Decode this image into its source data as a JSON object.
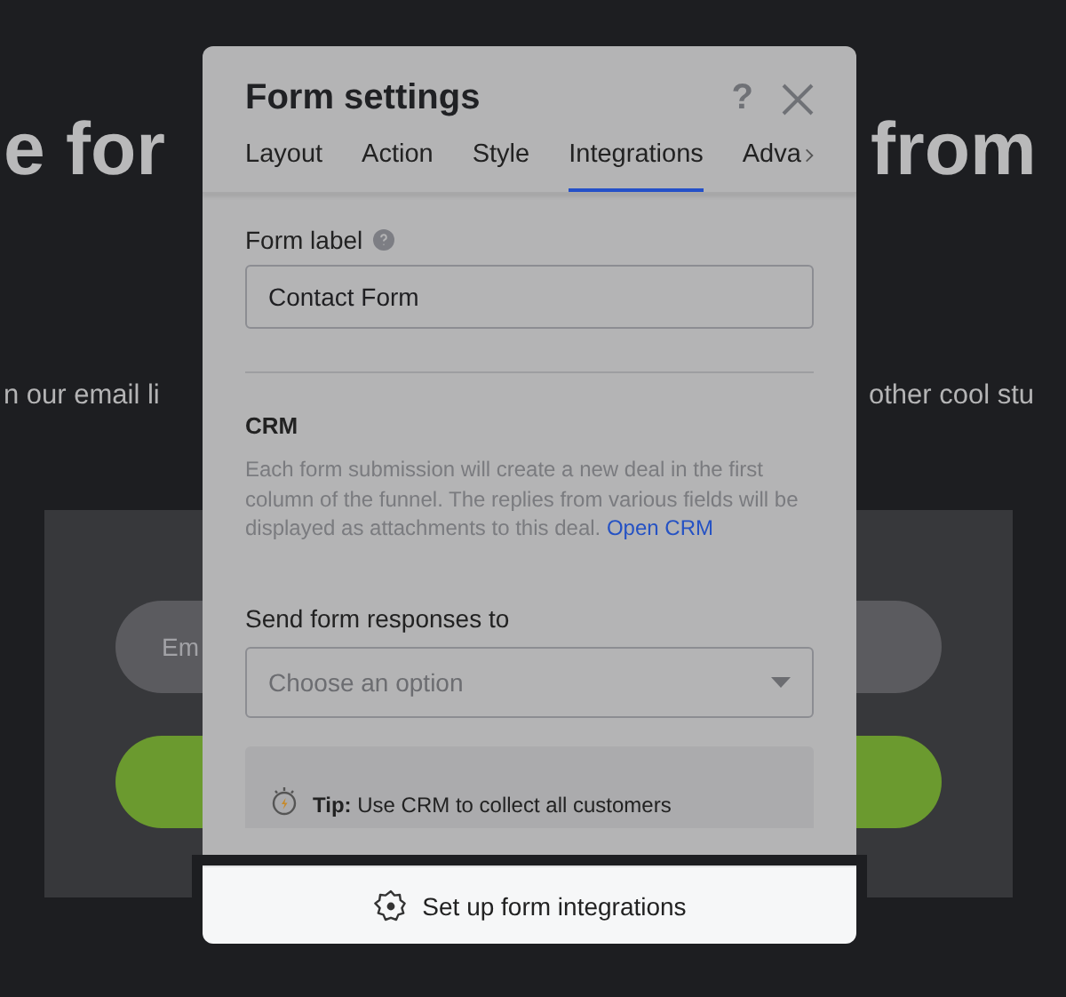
{
  "background": {
    "headline_left": "e for",
    "headline_right": "from",
    "subtitle_left": "n our email li",
    "subtitle_right": "other cool stu",
    "email_placeholder": "Em"
  },
  "dialog": {
    "title": "Form settings",
    "help": "?",
    "tabs": [
      {
        "label": "Layout",
        "selected": false
      },
      {
        "label": "Action",
        "selected": false
      },
      {
        "label": "Style",
        "selected": false
      },
      {
        "label": "Integrations",
        "selected": true
      },
      {
        "label": "Adva",
        "selected": false
      }
    ],
    "form_label": {
      "label": "Form label",
      "value": "Contact Form"
    },
    "crm": {
      "heading": "CRM",
      "description": "Each form submission will create a new deal in the first column of the funnel. The replies from various fields will be displayed as attachments to this deal.",
      "link": "Open CRM"
    },
    "send_responses": {
      "label": "Send form responses to",
      "placeholder": "Choose an option"
    },
    "tip": {
      "text": "**Tip:** Use CRM to collect all customers"
    },
    "footer_button": "Set up form integrations"
  }
}
